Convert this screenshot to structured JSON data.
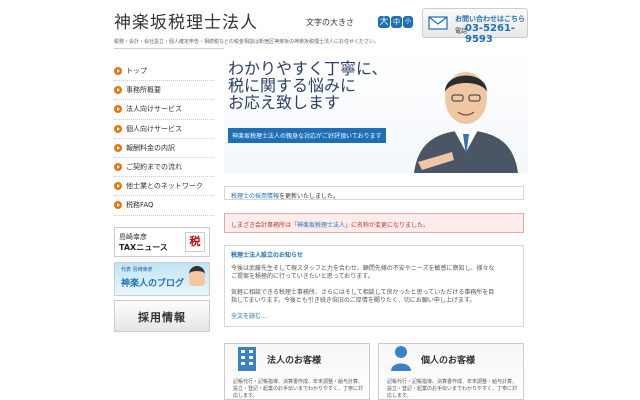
{
  "header": {
    "site_title": "神楽坂税理士法人",
    "font_size_label": "文字の大きさ",
    "font_sizes": [
      "大",
      "中",
      "小"
    ],
    "contact_label": "お問い合わせはこちら",
    "tel_label": "電話",
    "tel": "03-5261-9593",
    "tagline": "税務・会計・会社設立・個人確定申告・相続税などの税金相談は新宿区神楽坂の神楽坂税理士法人にお任せください。"
  },
  "nav": {
    "items": [
      "トップ",
      "事務所概要",
      "法人向けサービス",
      "個人向けサービス",
      "報酬料金の内訳",
      "ご契約までの流れ",
      "他士業とのネットワーク",
      "税務FAQ"
    ]
  },
  "banners": {
    "news_line1": "島崎幸彦",
    "news_line2": "TAXニュース",
    "news_badge": "税",
    "blog_line1": "代表 島崎幸彦",
    "blog_line2": "神楽人のブログ",
    "recruit": "採用情報"
  },
  "hero": {
    "headline_1": "わかりやすく丁寧に、",
    "headline_2": "税に関する悩みに",
    "headline_3": "お応え致します",
    "subline": "神楽坂税理士法人の親身な対応がご好評頂いております"
  },
  "notices": {
    "n1_link": "税理士の採用情報",
    "n1_rest": "を更新いたしました。",
    "n2_pre": "しまざき会計事務所は「",
    "n2_link": "神楽坂税理士法人",
    "n2_post": "」に名称が変更になりました。"
  },
  "news": {
    "title": "税理士法人設立のお知らせ",
    "line1": "今後は武藤先生そして現スタッフと力を合わせ、顧問先様の不安やニーズを敏感に察知し、様々な",
    "line2": "ご提案を積極的に行っていきたいと思っております。",
    "line3": "気軽に相談できる税理士事務所、さらにはそして相談して良かったと思っていただける事務所を目",
    "line4": "指してまいります。今後とも引き続き倍旧のご厚情を賜りたく、切にお願い申し上げます。",
    "more": "全文を読む..."
  },
  "services": {
    "corp_title": "法人のお客様",
    "corp_desc": "記帳代行・記帳指導、決算書作成、年末調整・給与計算、設立・登記・起業のお手伝いまでわかりやすく、丁寧に対応します。",
    "indiv_title": "個人のお客様",
    "indiv_desc": "記帳代行・記帳指導、決算書作成、年末調整・給与計算、設立・登記・起業のお手伝いまでわかりやすく、丁寧に対応します。"
  },
  "colors": {
    "accent": "#1d6fb8",
    "nav_bullet": "#e4770c",
    "alert": "#c0392b"
  }
}
